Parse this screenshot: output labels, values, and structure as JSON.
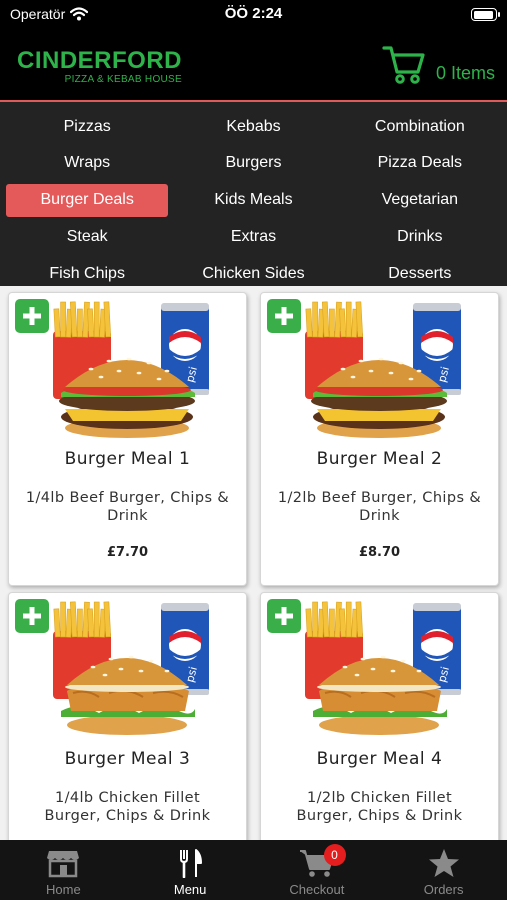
{
  "status_bar": {
    "carrier": "Operatör",
    "time": "ÖÖ 2:24"
  },
  "header": {
    "brand": "CINDERFORD",
    "tagline": "PIZZA & KEBAB HOUSE",
    "cart_label": "0 Items"
  },
  "categories": [
    "Pizzas",
    "Kebabs",
    "Combination",
    "Wraps",
    "Burgers",
    "Pizza Deals",
    "Burger Deals",
    "Kids Meals",
    "Vegetarian",
    "Steak",
    "Extras",
    "Drinks",
    "Fish Chips",
    "Chicken Sides",
    "Desserts"
  ],
  "selected_category": "Burger Deals",
  "products": [
    {
      "name": "Burger Meal 1",
      "description": "1/4lb Beef Burger, Chips & Drink",
      "price": "£7.70"
    },
    {
      "name": "Burger Meal 2",
      "description": "1/2lb Beef Burger, Chips & Drink",
      "price": "£8.70"
    },
    {
      "name": "Burger Meal 3",
      "description": "1/4lb Chicken Fillet Burger, Chips & Drink",
      "price": ""
    },
    {
      "name": "Burger Meal 4",
      "description": "1/2lb Chicken Fillet Burger, Chips & Drink",
      "price": ""
    }
  ],
  "tabs": [
    {
      "label": "Home",
      "icon": "store-icon"
    },
    {
      "label": "Menu",
      "icon": "fork-knife-icon"
    },
    {
      "label": "Checkout",
      "icon": "cart-icon"
    },
    {
      "label": "Orders",
      "icon": "star-icon"
    }
  ],
  "active_tab": "Menu",
  "checkout_badge": "0",
  "colors": {
    "brand_green": "#2db34a",
    "accent_red": "#e45a5a",
    "add_button_green": "#3aae49",
    "header_bg": "#000000",
    "category_bg": "#232323",
    "tabbar_bg": "#141414"
  }
}
